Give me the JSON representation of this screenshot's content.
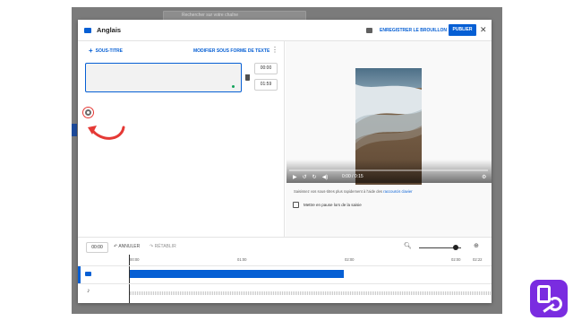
{
  "background": {
    "search_placeholder": "Rechercher sur votre chaîne"
  },
  "dialog": {
    "title": "Anglais",
    "save_draft_label": "ENREGISTRER LE BROUILLON",
    "publish_label": "PUBLIER",
    "close_icon": "close-icon"
  },
  "editor": {
    "add_subtitle_label": "SOUS-TITRE",
    "edit_as_text_label": "MODIFIER SOUS FORME DE TEXTE",
    "subtitle_text": "",
    "start_time": "00:00",
    "end_time": "01:59"
  },
  "player": {
    "time_display": "0:00 / 0:15",
    "hint_prefix": "Saisissez vos sous-titres plus rapidement à l'aide des",
    "hint_link": "raccourcis clavier",
    "pause_while_typing_label": "Mettre en pause lors de la saisie",
    "pause_while_typing_checked": false
  },
  "timeline": {
    "current_time": "00:00",
    "undo_label": "ANNULER",
    "redo_label": "RÉTABLIR",
    "ticks": [
      "00:00",
      "01:00",
      "02:00",
      "02:00",
      "02:22"
    ],
    "zoom_level": 0.8
  },
  "colors": {
    "accent": "#065fd4",
    "highlight_red": "#e53935",
    "logo_purple": "#7a2ce0"
  }
}
